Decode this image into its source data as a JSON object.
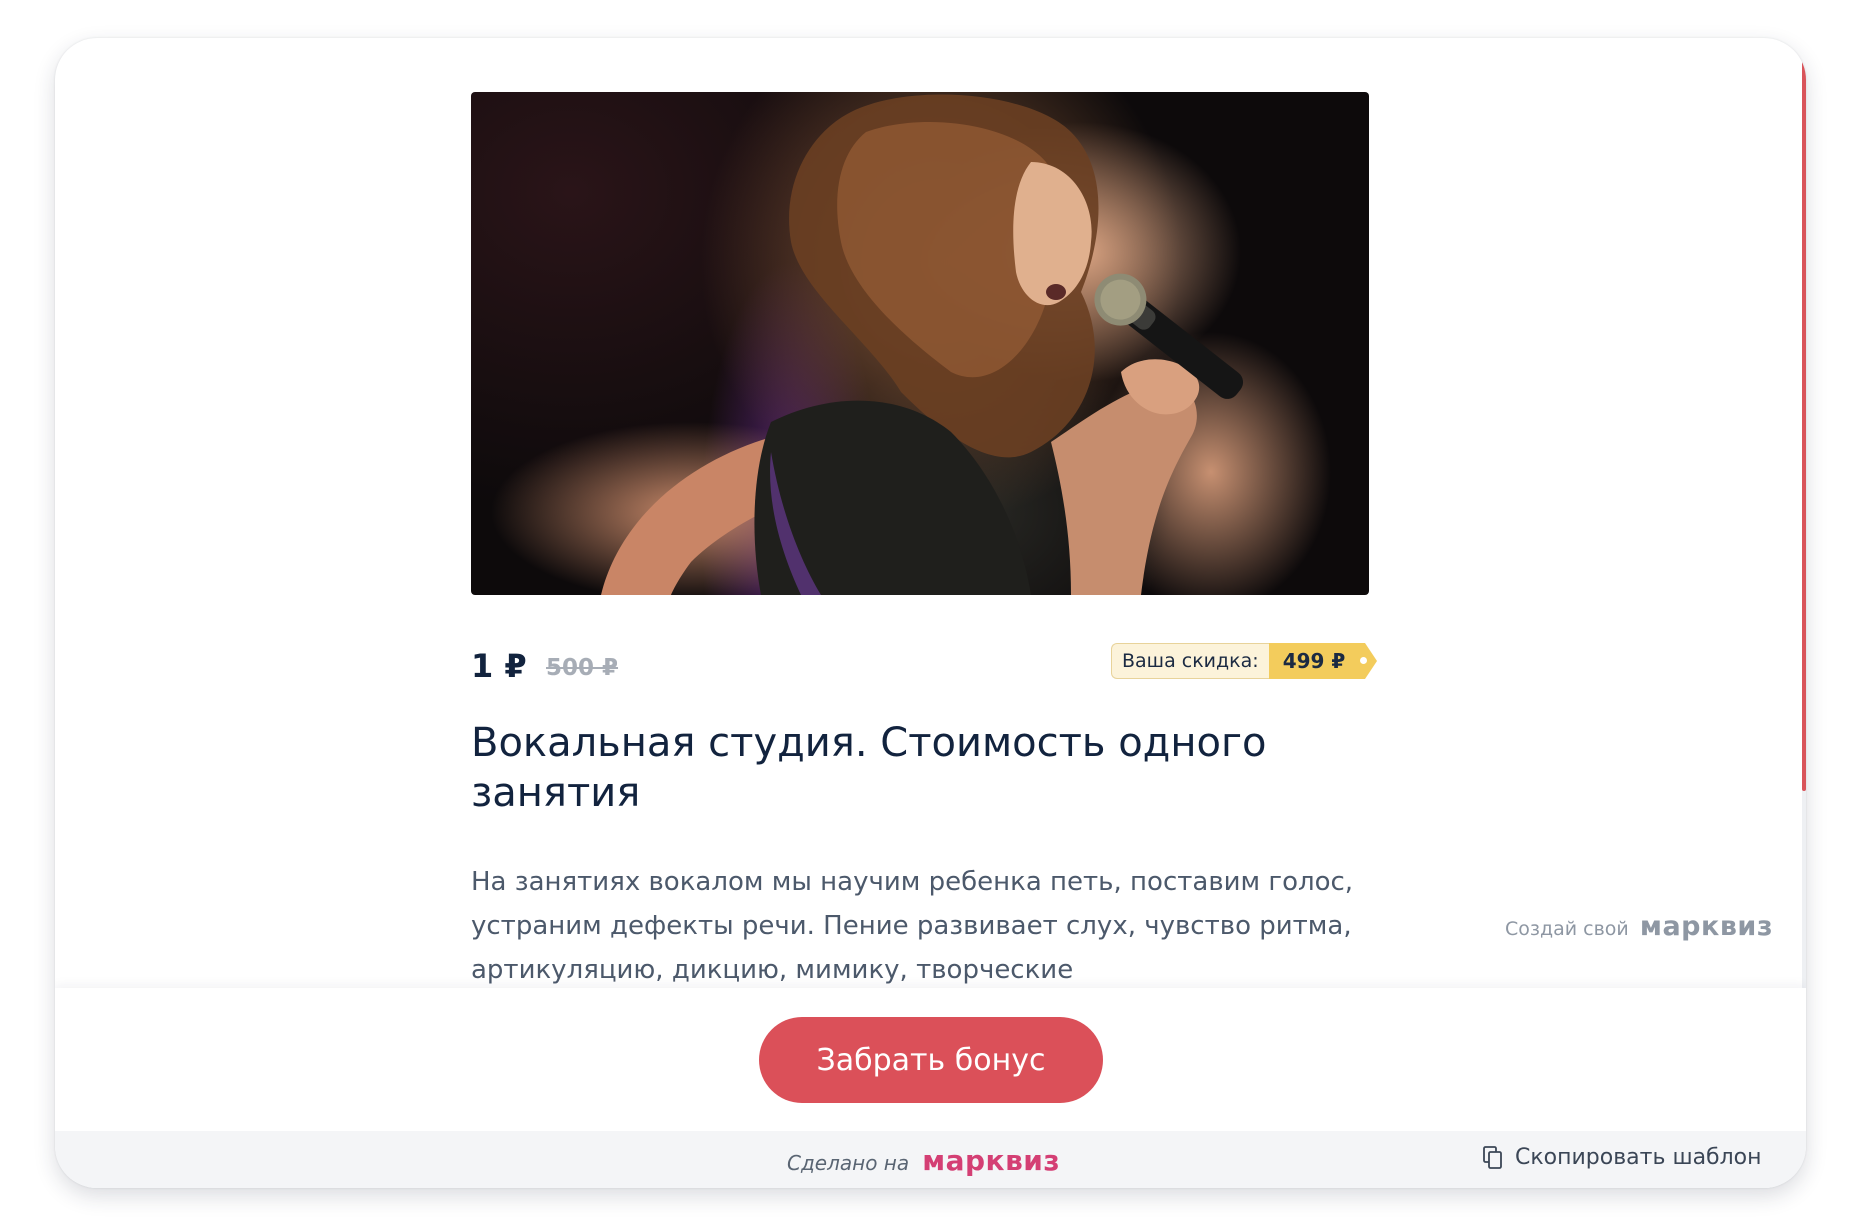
{
  "product": {
    "image_alt": "Девочка поёт в микрофон на сцене",
    "price_current": "1 ₽",
    "price_old": "500 ₽",
    "discount_label": "Ваша скидка:",
    "discount_value": "499 ₽",
    "title": "Вокальная студия. Стоимость одного занятия",
    "description": "На занятиях вокалом мы научим ребенка петь, поставим голос, устраним дефекты речи. Пение развивает слух, чувство ритма, артикуляцию, дикцию, мимику, творческие"
  },
  "promo": {
    "create_own_text": "Создай свой",
    "brand": "марквиз"
  },
  "cta": {
    "button_label": "Забрать бонус"
  },
  "footer": {
    "made_on_text": "Сделано на",
    "brand": "марквиз",
    "copy_template_label": "Скопировать шаблон"
  },
  "colors": {
    "accent": "#db5059",
    "brand_pink": "#d43f74",
    "discount_badge": "#f3cc5c",
    "title_text": "#12233e"
  }
}
